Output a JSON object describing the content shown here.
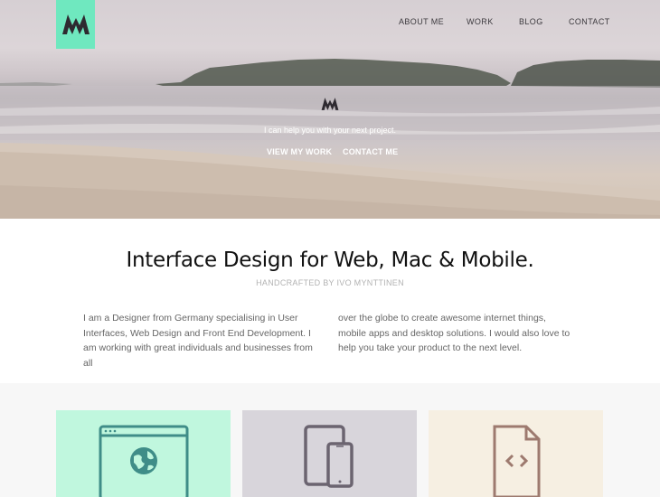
{
  "nav": {
    "items": [
      {
        "label": "About me"
      },
      {
        "label": "Work"
      },
      {
        "label": "Blog"
      },
      {
        "label": "Contact"
      }
    ]
  },
  "hero": {
    "tagline": "I can help you with your next project.",
    "primary_link": "View my work",
    "secondary_link": "Contact me"
  },
  "intro": {
    "headline": "Interface Design for Web, Mac & Mobile.",
    "subline": "HANDCRAFTED BY IVO MYNTTINEN",
    "col_left": "I am a Designer from Germany specialising in User Interfaces, Web Design and Front End Development. I am working with great individuals and businesses from all",
    "col_right": "over the globe to create awesome internet things, mobile apps and desktop solutions. I would also love to help you take your product to the next level."
  },
  "features": [
    {
      "icon": "browser-globe-icon",
      "color": "#c0f7de"
    },
    {
      "icon": "tablet-phone-icon",
      "color": "#d8d5db"
    },
    {
      "icon": "code-file-icon",
      "color": "#f6efe2"
    }
  ],
  "colors": {
    "accent": "#6fe8bf",
    "icon_stroke_web": "#3f8d88",
    "icon_stroke_device": "#6b6470",
    "icon_stroke_code": "#9d7a6f"
  }
}
